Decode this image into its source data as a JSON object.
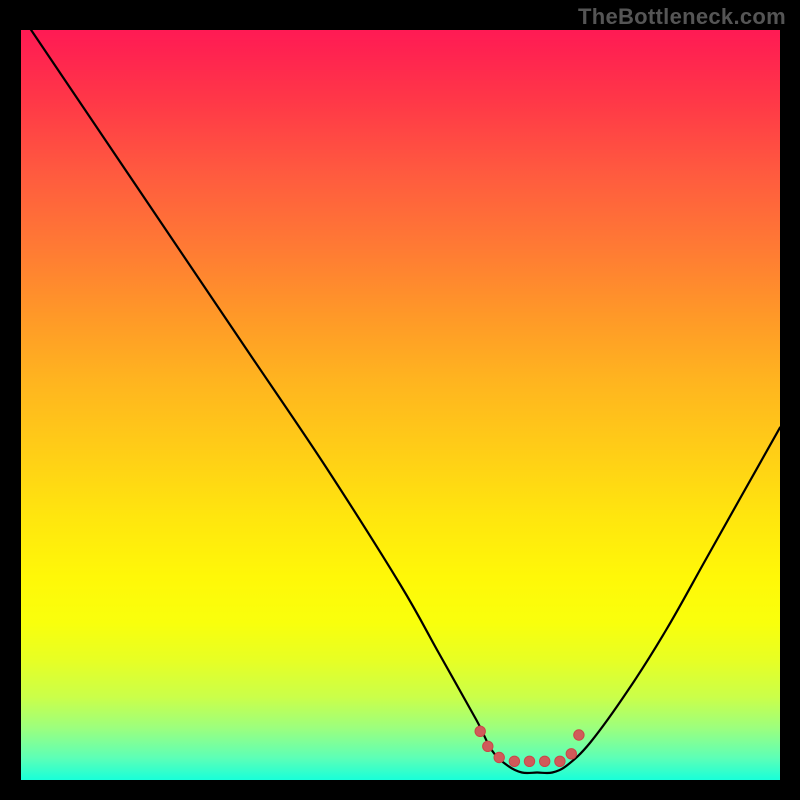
{
  "attribution": "TheBottleneck.com",
  "colors": {
    "background": "#000000",
    "curve": "#000000",
    "marker_fill": "#d05a5a",
    "marker_stroke": "#c94848",
    "gradient_top": "#ff1a54",
    "gradient_mid": "#fff808",
    "gradient_bottom": "#18ffd9"
  },
  "chart_data": {
    "type": "line",
    "title": "",
    "xlabel": "",
    "ylabel": "",
    "xlim": [
      0,
      100
    ],
    "ylim": [
      0,
      100
    ],
    "x": [
      0,
      10,
      20,
      30,
      40,
      50,
      55,
      60,
      62,
      64,
      66,
      68,
      70,
      72,
      75,
      80,
      85,
      90,
      95,
      100
    ],
    "values": [
      102,
      87,
      72,
      57,
      42,
      26,
      17,
      8,
      4,
      2,
      1,
      1,
      1,
      2,
      5,
      12,
      20,
      29,
      38,
      47
    ],
    "annotations": {
      "markers": [
        {
          "x": 60.5,
          "y": 6.5
        },
        {
          "x": 61.5,
          "y": 4.5
        },
        {
          "x": 63,
          "y": 3
        },
        {
          "x": 65,
          "y": 2.5
        },
        {
          "x": 67,
          "y": 2.5
        },
        {
          "x": 69,
          "y": 2.5
        },
        {
          "x": 71,
          "y": 2.5
        },
        {
          "x": 72.5,
          "y": 3.5
        },
        {
          "x": 73.5,
          "y": 6
        }
      ]
    }
  }
}
